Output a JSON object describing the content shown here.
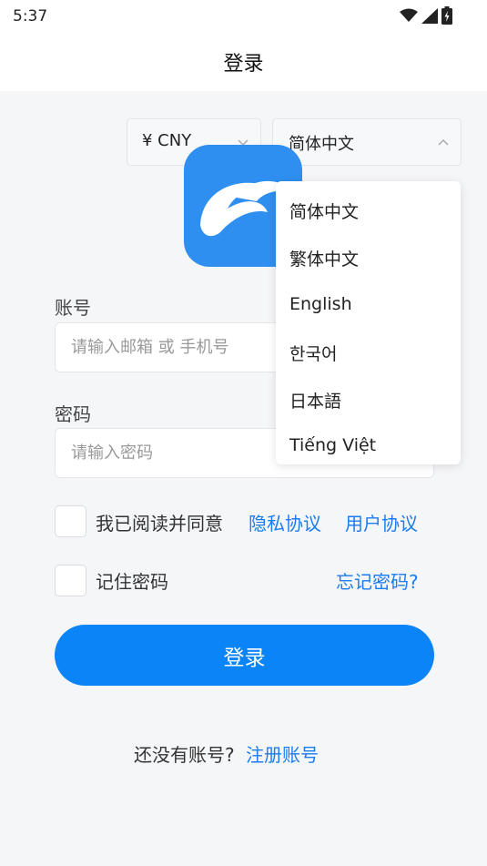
{
  "status_bar": {
    "time": "5:37",
    "icons": [
      "wifi-icon",
      "signal-icon",
      "battery-icon"
    ]
  },
  "header": {
    "title": "登录"
  },
  "currency_select": {
    "value": "¥ CNY"
  },
  "language_select": {
    "value": "简体中文",
    "open": true,
    "options": [
      "简体中文",
      "繁体中文",
      "English",
      "한국어",
      "日本語",
      "Tiếng Việt"
    ]
  },
  "form": {
    "account_label": "账号",
    "account_placeholder": "请输入邮箱 或 手机号",
    "password_label": "密码",
    "password_placeholder": "请输入密码",
    "agree_text": "我已阅读并同意",
    "privacy_link": "隐私协议",
    "user_link": "用户协议",
    "remember_text": "记住密码",
    "forgot_link": "忘记密码?",
    "login_button": "登录"
  },
  "footer": {
    "no_account_text": "还没有账号?",
    "register_link": "注册账号"
  },
  "colors": {
    "brand": "#0a84f7",
    "link": "#1a7cf0",
    "logo_bg": "#2e8ff0",
    "page_bg": "#f5f6f8"
  }
}
